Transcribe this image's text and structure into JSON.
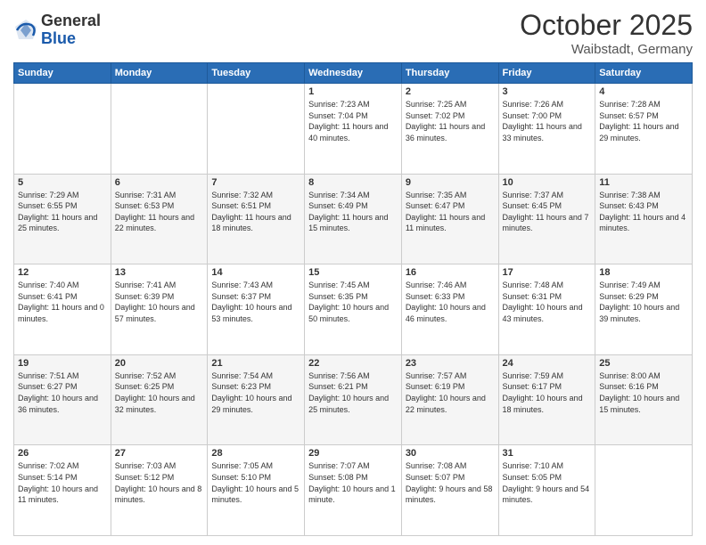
{
  "header": {
    "logo_general": "General",
    "logo_blue": "Blue",
    "month": "October 2025",
    "location": "Waibstadt, Germany"
  },
  "days_of_week": [
    "Sunday",
    "Monday",
    "Tuesday",
    "Wednesday",
    "Thursday",
    "Friday",
    "Saturday"
  ],
  "weeks": [
    [
      {
        "day": "",
        "info": ""
      },
      {
        "day": "",
        "info": ""
      },
      {
        "day": "",
        "info": ""
      },
      {
        "day": "1",
        "info": "Sunrise: 7:23 AM\nSunset: 7:04 PM\nDaylight: 11 hours and 40 minutes."
      },
      {
        "day": "2",
        "info": "Sunrise: 7:25 AM\nSunset: 7:02 PM\nDaylight: 11 hours and 36 minutes."
      },
      {
        "day": "3",
        "info": "Sunrise: 7:26 AM\nSunset: 7:00 PM\nDaylight: 11 hours and 33 minutes."
      },
      {
        "day": "4",
        "info": "Sunrise: 7:28 AM\nSunset: 6:57 PM\nDaylight: 11 hours and 29 minutes."
      }
    ],
    [
      {
        "day": "5",
        "info": "Sunrise: 7:29 AM\nSunset: 6:55 PM\nDaylight: 11 hours and 25 minutes."
      },
      {
        "day": "6",
        "info": "Sunrise: 7:31 AM\nSunset: 6:53 PM\nDaylight: 11 hours and 22 minutes."
      },
      {
        "day": "7",
        "info": "Sunrise: 7:32 AM\nSunset: 6:51 PM\nDaylight: 11 hours and 18 minutes."
      },
      {
        "day": "8",
        "info": "Sunrise: 7:34 AM\nSunset: 6:49 PM\nDaylight: 11 hours and 15 minutes."
      },
      {
        "day": "9",
        "info": "Sunrise: 7:35 AM\nSunset: 6:47 PM\nDaylight: 11 hours and 11 minutes."
      },
      {
        "day": "10",
        "info": "Sunrise: 7:37 AM\nSunset: 6:45 PM\nDaylight: 11 hours and 7 minutes."
      },
      {
        "day": "11",
        "info": "Sunrise: 7:38 AM\nSunset: 6:43 PM\nDaylight: 11 hours and 4 minutes."
      }
    ],
    [
      {
        "day": "12",
        "info": "Sunrise: 7:40 AM\nSunset: 6:41 PM\nDaylight: 11 hours and 0 minutes."
      },
      {
        "day": "13",
        "info": "Sunrise: 7:41 AM\nSunset: 6:39 PM\nDaylight: 10 hours and 57 minutes."
      },
      {
        "day": "14",
        "info": "Sunrise: 7:43 AM\nSunset: 6:37 PM\nDaylight: 10 hours and 53 minutes."
      },
      {
        "day": "15",
        "info": "Sunrise: 7:45 AM\nSunset: 6:35 PM\nDaylight: 10 hours and 50 minutes."
      },
      {
        "day": "16",
        "info": "Sunrise: 7:46 AM\nSunset: 6:33 PM\nDaylight: 10 hours and 46 minutes."
      },
      {
        "day": "17",
        "info": "Sunrise: 7:48 AM\nSunset: 6:31 PM\nDaylight: 10 hours and 43 minutes."
      },
      {
        "day": "18",
        "info": "Sunrise: 7:49 AM\nSunset: 6:29 PM\nDaylight: 10 hours and 39 minutes."
      }
    ],
    [
      {
        "day": "19",
        "info": "Sunrise: 7:51 AM\nSunset: 6:27 PM\nDaylight: 10 hours and 36 minutes."
      },
      {
        "day": "20",
        "info": "Sunrise: 7:52 AM\nSunset: 6:25 PM\nDaylight: 10 hours and 32 minutes."
      },
      {
        "day": "21",
        "info": "Sunrise: 7:54 AM\nSunset: 6:23 PM\nDaylight: 10 hours and 29 minutes."
      },
      {
        "day": "22",
        "info": "Sunrise: 7:56 AM\nSunset: 6:21 PM\nDaylight: 10 hours and 25 minutes."
      },
      {
        "day": "23",
        "info": "Sunrise: 7:57 AM\nSunset: 6:19 PM\nDaylight: 10 hours and 22 minutes."
      },
      {
        "day": "24",
        "info": "Sunrise: 7:59 AM\nSunset: 6:17 PM\nDaylight: 10 hours and 18 minutes."
      },
      {
        "day": "25",
        "info": "Sunrise: 8:00 AM\nSunset: 6:16 PM\nDaylight: 10 hours and 15 minutes."
      }
    ],
    [
      {
        "day": "26",
        "info": "Sunrise: 7:02 AM\nSunset: 5:14 PM\nDaylight: 10 hours and 11 minutes."
      },
      {
        "day": "27",
        "info": "Sunrise: 7:03 AM\nSunset: 5:12 PM\nDaylight: 10 hours and 8 minutes."
      },
      {
        "day": "28",
        "info": "Sunrise: 7:05 AM\nSunset: 5:10 PM\nDaylight: 10 hours and 5 minutes."
      },
      {
        "day": "29",
        "info": "Sunrise: 7:07 AM\nSunset: 5:08 PM\nDaylight: 10 hours and 1 minute."
      },
      {
        "day": "30",
        "info": "Sunrise: 7:08 AM\nSunset: 5:07 PM\nDaylight: 9 hours and 58 minutes."
      },
      {
        "day": "31",
        "info": "Sunrise: 7:10 AM\nSunset: 5:05 PM\nDaylight: 9 hours and 54 minutes."
      },
      {
        "day": "",
        "info": ""
      }
    ]
  ]
}
